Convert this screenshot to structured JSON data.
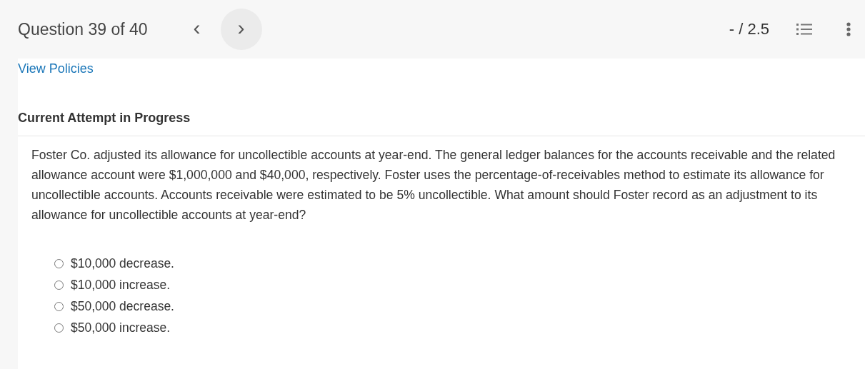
{
  "header": {
    "title": "Question 39 of 40",
    "prev": "‹",
    "next": "›",
    "score": "- / 2.5"
  },
  "view_policies": "View Policies",
  "section_title": "Current Attempt in Progress",
  "question": "Foster Co. adjusted its allowance for uncollectible accounts at year-end. The general ledger balances for the accounts receivable and the related allowance account were $1,000,000 and $40,000, respectively. Foster uses the percentage-of-receivables method to estimate its allowance for uncollectible accounts. Accounts receivable were estimated to be 5% uncollectible. What amount should Foster record as an adjustment to its allowance for uncollectible accounts at year-end?",
  "options": [
    {
      "label": "$10,000 decrease.",
      "selected": false
    },
    {
      "label": "$10,000 increase.",
      "selected": false
    },
    {
      "label": "$50,000 decrease.",
      "selected": false
    },
    {
      "label": "$50,000 increase.",
      "selected": false
    }
  ]
}
